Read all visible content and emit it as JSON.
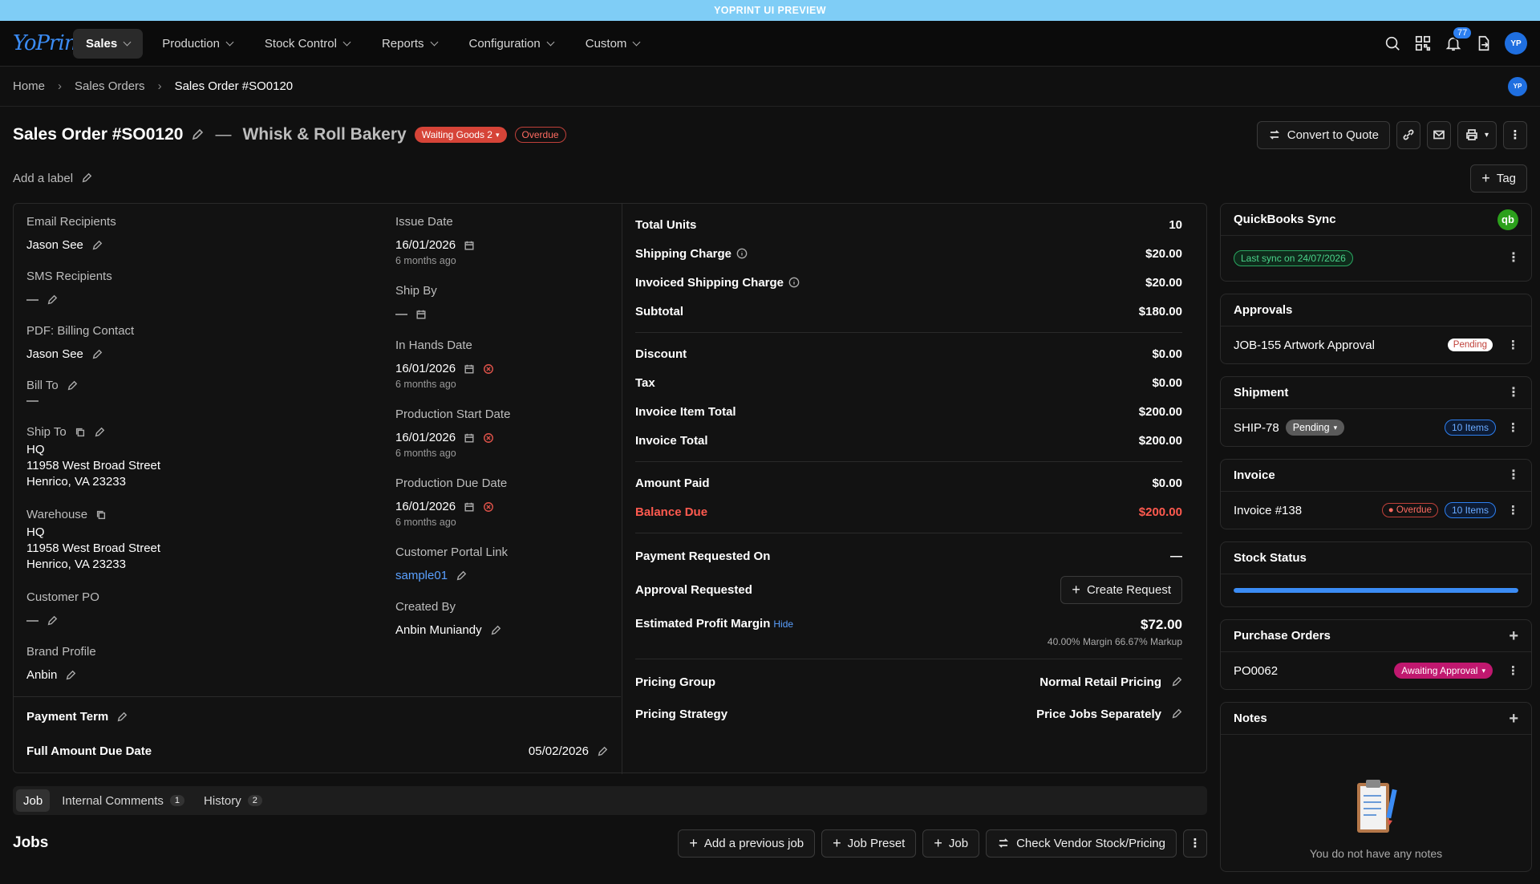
{
  "preview_banner": "YOPRINT UI PREVIEW",
  "logo": "YoPrint",
  "nav": {
    "items": [
      {
        "label": "Sales"
      },
      {
        "label": "Production"
      },
      {
        "label": "Stock Control"
      },
      {
        "label": "Reports"
      },
      {
        "label": "Configuration"
      },
      {
        "label": "Custom"
      }
    ],
    "notification_count": "77",
    "avatar_initials": "YP"
  },
  "breadcrumb": {
    "home": "Home",
    "sales_orders": "Sales Orders",
    "current": "Sales Order #SO0120",
    "avatar_initials": "YP"
  },
  "header": {
    "title": "Sales Order #SO0120",
    "dash": "—",
    "customer": "Whisk & Roll Bakery",
    "status": "Waiting Goods 2",
    "overdue": "Overdue",
    "convert_label": "Convert to Quote",
    "add_label": "Add a label",
    "tag_label": "Tag"
  },
  "details": {
    "email_recipients": {
      "label": "Email Recipients",
      "value": "Jason See"
    },
    "sms_recipients": {
      "label": "SMS Recipients",
      "value": "—"
    },
    "pdf_billing": {
      "label": "PDF: Billing Contact",
      "value": "Jason See"
    },
    "bill_to": {
      "label": "Bill To",
      "value": "—"
    },
    "ship_to": {
      "label": "Ship To",
      "name": "HQ",
      "line1": "11958 West Broad Street",
      "line2": "Henrico, VA 23233"
    },
    "warehouse": {
      "label": "Warehouse",
      "name": "HQ",
      "line1": "11958 West Broad Street",
      "line2": "Henrico, VA 23233"
    },
    "customer_po": {
      "label": "Customer PO",
      "value": "—"
    },
    "brand_profile": {
      "label": "Brand Profile",
      "value": "Anbin"
    },
    "issue_date": {
      "label": "Issue Date",
      "value": "16/01/2026",
      "ago": "6 months ago"
    },
    "ship_by": {
      "label": "Ship By",
      "value": "—"
    },
    "in_hands": {
      "label": "In Hands Date",
      "value": "16/01/2026",
      "ago": "6 months ago"
    },
    "prod_start": {
      "label": "Production Start Date",
      "value": "16/01/2026",
      "ago": "6 months ago"
    },
    "prod_due": {
      "label": "Production Due Date",
      "value": "16/01/2026",
      "ago": "6 months ago"
    },
    "portal": {
      "label": "Customer Portal Link",
      "value": "sample01"
    },
    "created_by": {
      "label": "Created By",
      "value": "Anbin Muniandy"
    },
    "payment_term": {
      "label": "Payment Term"
    },
    "full_due": {
      "label": "Full Amount Due Date",
      "value": "05/02/2026"
    }
  },
  "summary": {
    "total_units": {
      "label": "Total Units",
      "value": "10"
    },
    "shipping": {
      "label": "Shipping Charge",
      "value": "$20.00"
    },
    "inv_shipping": {
      "label": "Invoiced Shipping Charge",
      "value": "$20.00"
    },
    "subtotal": {
      "label": "Subtotal",
      "value": "$180.00"
    },
    "discount": {
      "label": "Discount",
      "value": "$0.00"
    },
    "tax": {
      "label": "Tax",
      "value": "$0.00"
    },
    "inv_item_total": {
      "label": "Invoice Item Total",
      "value": "$200.00"
    },
    "inv_total": {
      "label": "Invoice Total",
      "value": "$200.00"
    },
    "amount_paid": {
      "label": "Amount Paid",
      "value": "$0.00"
    },
    "balance_due": {
      "label": "Balance Due",
      "value": "$200.00"
    },
    "payment_requested": {
      "label": "Payment Requested On",
      "value": "—"
    },
    "approval_requested": {
      "label": "Approval Requested",
      "button": "Create Request"
    },
    "profit": {
      "label": "Estimated Profit Margin",
      "hide": "Hide",
      "value": "$72.00",
      "detail": "40.00% Margin 66.67% Markup"
    },
    "pricing_group": {
      "label": "Pricing Group",
      "value": "Normal Retail Pricing"
    },
    "pricing_strategy": {
      "label": "Pricing Strategy",
      "value": "Price Jobs Separately"
    }
  },
  "side": {
    "qb": {
      "title": "QuickBooks Sync",
      "badge": "Last sync on 24/07/2026",
      "logo": "qb"
    },
    "approvals": {
      "title": "Approvals",
      "item": "JOB-155 Artwork Approval",
      "status": "Pending"
    },
    "shipment": {
      "title": "Shipment",
      "item": "SHIP-78",
      "status": "Pending",
      "items": "10 Items"
    },
    "invoice": {
      "title": "Invoice",
      "item": "Invoice #138",
      "status": "Overdue",
      "items": "10 Items"
    },
    "stock": {
      "title": "Stock Status",
      "progress": 1.0
    },
    "po": {
      "title": "Purchase Orders",
      "item": "PO0062",
      "status": "Awaiting Approval"
    },
    "notes": {
      "title": "Notes",
      "empty": "You do not have any notes"
    }
  },
  "tabs": [
    {
      "label": "Job"
    },
    {
      "label": "Internal Comments",
      "count": "1"
    },
    {
      "label": "History",
      "count": "2"
    }
  ],
  "jobs": {
    "title": "Jobs",
    "add_prev": "Add a previous job",
    "preset": "Job Preset",
    "job": "Job",
    "vendor": "Check Vendor Stock/Pricing"
  },
  "colors": {
    "accent": "#3b8cf5",
    "danger": "#d64438",
    "success": "#2ca01c"
  }
}
